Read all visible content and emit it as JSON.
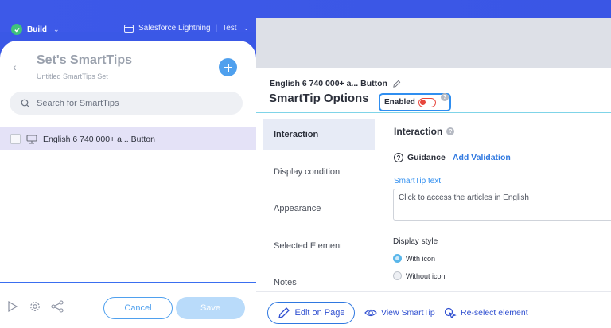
{
  "topbar": {
    "build_label": "Build",
    "env_label": "Salesforce Lightning",
    "env_sep": "|",
    "env_mode": "Test"
  },
  "left_panel": {
    "title": "Set's SmartTips",
    "subtitle": "Untitled SmartTips Set",
    "search_placeholder": "Search for SmartTips",
    "items": [
      {
        "label": "English 6 740 000+ a... Button"
      }
    ],
    "cancel_label": "Cancel",
    "save_label": "Save"
  },
  "right_panel": {
    "element_name": "English 6 740 000+ a... Button",
    "options_title": "SmartTip Options",
    "enabled_label": "Enabled",
    "enabled_state": "off",
    "nav": [
      {
        "label": "Interaction",
        "active": true
      },
      {
        "label": "Display condition",
        "active": false
      },
      {
        "label": "Appearance",
        "active": false
      },
      {
        "label": "Selected Element",
        "active": false
      },
      {
        "label": "Notes",
        "active": false
      }
    ],
    "section_title": "Interaction",
    "guidance_label": "Guidance",
    "add_validation_label": "Add Validation",
    "smarttip_text_label": "SmartTip text",
    "smarttip_text_value": "Click to access the articles in English",
    "display_style_label": "Display style",
    "display_options": [
      {
        "label": "With icon",
        "selected": true
      },
      {
        "label": "Without icon",
        "selected": false
      }
    ],
    "edit_on_page_label": "Edit on Page",
    "view_smarttip_label": "View SmartTip",
    "reselect_label": "Re-select element"
  },
  "colors": {
    "brand_blue": "#3a58e6",
    "accent_link": "#2f78e0",
    "toggle_off": "#e7463c",
    "selected_row": "#e4e2f7"
  }
}
